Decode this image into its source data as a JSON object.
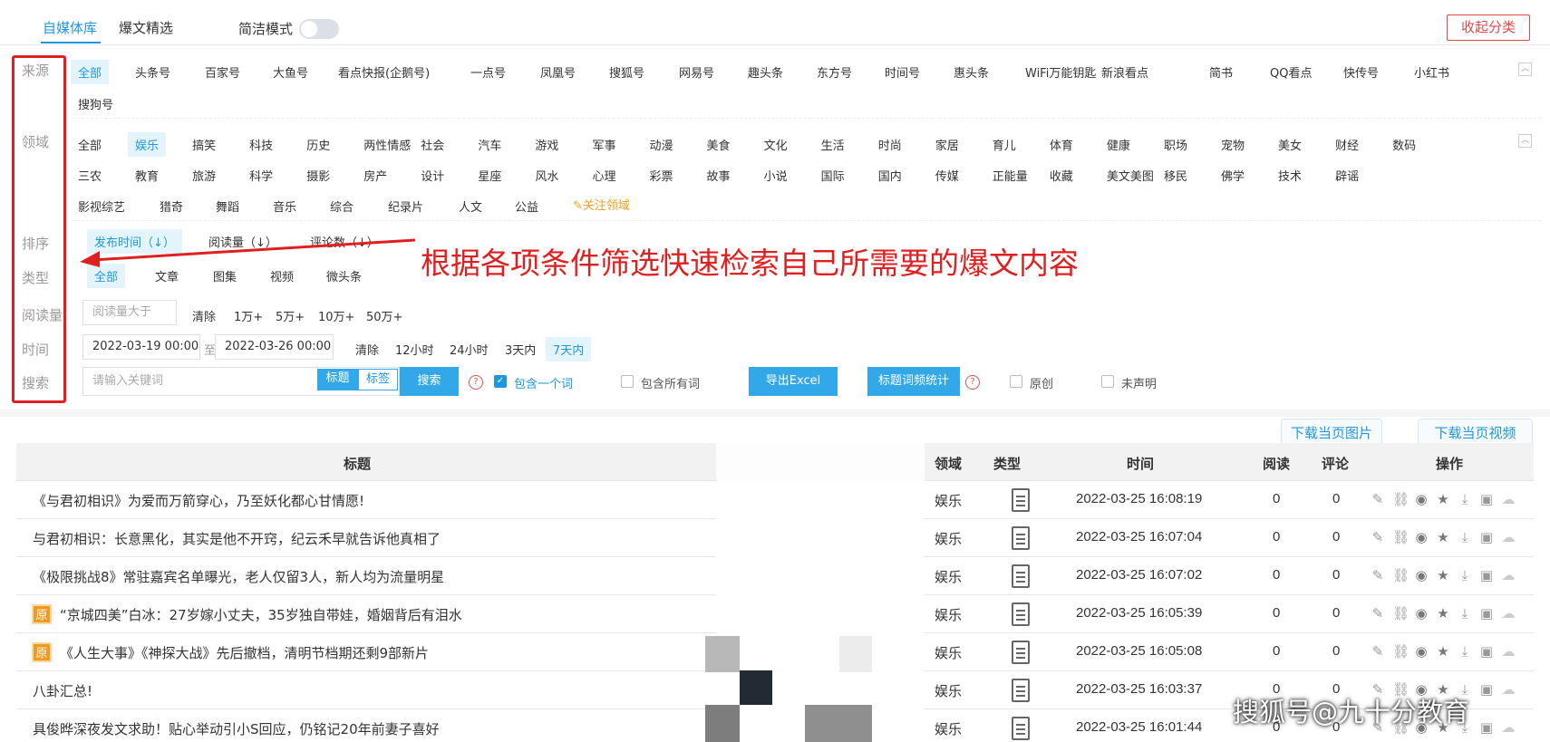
{
  "tabs": {
    "media_lib": "自媒体库",
    "viral": "爆文精选",
    "simple_mode": "简洁模式",
    "collapse": "收起分类"
  },
  "labels": {
    "source": "来源",
    "domain": "领域",
    "sort": "排序",
    "type": "类型",
    "reads": "阅读量",
    "time": "时间",
    "search": "搜索"
  },
  "sources_row1": [
    "全部",
    "头条号",
    "百家号",
    "大鱼号",
    "看点快报(企鹅号)",
    "一点号",
    "凤凰号",
    "搜狐号",
    "网易号",
    "趣头条",
    "东方号",
    "时间号",
    "惠头条",
    "WiFi万能钥匙",
    "新浪看点",
    "简书",
    "QQ看点",
    "快传号",
    "小红书"
  ],
  "sources_row2": [
    "搜狗号"
  ],
  "domains_row1": [
    "全部",
    "娱乐",
    "搞笑",
    "科技",
    "历史",
    "两性情感",
    "社会",
    "汽车",
    "游戏",
    "军事",
    "动漫",
    "美食",
    "文化",
    "生活",
    "时尚",
    "家居",
    "育儿",
    "体育",
    "健康",
    "职场",
    "宠物",
    "美女",
    "财经",
    "数码"
  ],
  "domains_row2": [
    "三农",
    "教育",
    "旅游",
    "科学",
    "摄影",
    "房产",
    "设计",
    "星座",
    "风水",
    "心理",
    "彩票",
    "故事",
    "小说",
    "国际",
    "国内",
    "传媒",
    "正能量",
    "收藏",
    "美文美图",
    "移民",
    "佛学",
    "技术",
    "辟谣"
  ],
  "domains_row3": [
    "影视综艺",
    "猎奇",
    "舞蹈",
    "音乐",
    "综合",
    "纪录片",
    "人文",
    "公益"
  ],
  "follow_domain": "关注领域",
  "sort_opts": [
    "发布时间（↓）",
    "阅读量（↓）",
    "评论数（↓）"
  ],
  "type_opts": [
    "全部",
    "文章",
    "图集",
    "视频",
    "微头条"
  ],
  "reads": {
    "placeholder": "阅读量大于",
    "opts": [
      "清除",
      "1万+",
      "5万+",
      "10万+",
      "50万+"
    ]
  },
  "time": {
    "start": "2022-03-19 00:00",
    "to": "至",
    "end": "2022-03-26 00:00",
    "opts": [
      "清除",
      "12小时",
      "24小时",
      "3天内",
      "7天内"
    ]
  },
  "search": {
    "placeholder": "请输入关键词",
    "seg_title": "标题",
    "seg_tag": "标签",
    "button": "搜索",
    "include_one": "包含一个词",
    "include_all": "包含所有词",
    "export": "导出Excel",
    "keyword_stats": "标题词频统计",
    "original": "原创",
    "undeclared": "未声明"
  },
  "annotation": "根据各项条件筛选快速检索自己所需要的爆文内容",
  "download": {
    "images": "下载当页图片",
    "videos": "下载当页视频"
  },
  "table": {
    "headers": {
      "title": "标题",
      "domain": "领域",
      "type": "类型",
      "time": "时间",
      "reads": "阅读",
      "comments": "评论",
      "ops": "操作"
    },
    "original_badge": "原",
    "rows": [
      {
        "title": "《与君初相识》为爱而万箭穿心，乃至妖化都心甘情愿!",
        "domain": "娱乐",
        "time": "2022-03-25 16:08:19",
        "reads": "0",
        "comments": "0",
        "original": false
      },
      {
        "title": "与君初相识：长意黑化，其实是他不开窍，纪云禾早就告诉他真相了",
        "domain": "娱乐",
        "time": "2022-03-25 16:07:04",
        "reads": "0",
        "comments": "0",
        "original": false
      },
      {
        "title": "《极限挑战8》常驻嘉宾名单曝光，老人仅留3人，新人均为流量明星",
        "domain": "娱乐",
        "time": "2022-03-25 16:07:02",
        "reads": "0",
        "comments": "0",
        "original": false
      },
      {
        "title": "“京城四美”白冰：27岁嫁小丈夫，35岁独自带娃，婚姻背后有泪水",
        "domain": "娱乐",
        "time": "2022-03-25 16:05:39",
        "reads": "0",
        "comments": "0",
        "original": true
      },
      {
        "title": "《人生大事》《神探大战》先后撤档，清明节档期还剩9部新片",
        "domain": "娱乐",
        "time": "2022-03-25 16:05:08",
        "reads": "0",
        "comments": "0",
        "original": true
      },
      {
        "title": "八卦汇总!",
        "domain": "娱乐",
        "time": "2022-03-25 16:03:37",
        "reads": "0",
        "comments": "0",
        "original": false
      },
      {
        "title": "具俊晔深夜发文求助！贴心举动引小S回应，仍铭记20年前妻子喜好",
        "domain": "娱乐",
        "time": "2022-03-25 16:01:44",
        "reads": "0",
        "comments": "0",
        "original": false
      }
    ]
  },
  "watermark": "搜狐号@九十分教育",
  "colors": {
    "accent": "#1e96e0",
    "annotation_red": "#e02020",
    "badge_orange": "#f39a1e"
  }
}
